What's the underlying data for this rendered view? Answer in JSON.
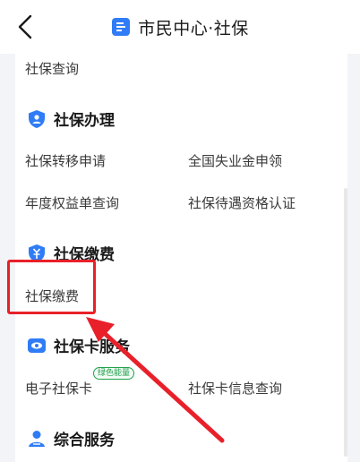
{
  "header": {
    "title": "市民中心·社保",
    "back_icon": "chevron-left-icon",
    "app_icon": "document-icon",
    "accent": "#2f7cf6"
  },
  "partial_item": {
    "label": "社保查询"
  },
  "sections": {
    "handle": {
      "title": "社保办理",
      "icon": "shield-icon",
      "items": [
        "社保转移申请",
        "全国失业金申领",
        "年度权益单查询",
        "社保待遇资格认证"
      ]
    },
    "payment": {
      "title": "社保缴费",
      "icon": "yuan-shield-icon",
      "items": [
        "社保缴费"
      ]
    },
    "card": {
      "title": "社保卡服务",
      "icon": "eye-card-icon",
      "items": [
        "电子社保卡",
        "社保卡信息查询"
      ],
      "badge": "绿色能量"
    },
    "general": {
      "title": "综合服务",
      "icon": "person-icon"
    }
  },
  "annotation": {
    "highlight_color": "#e8202a"
  }
}
